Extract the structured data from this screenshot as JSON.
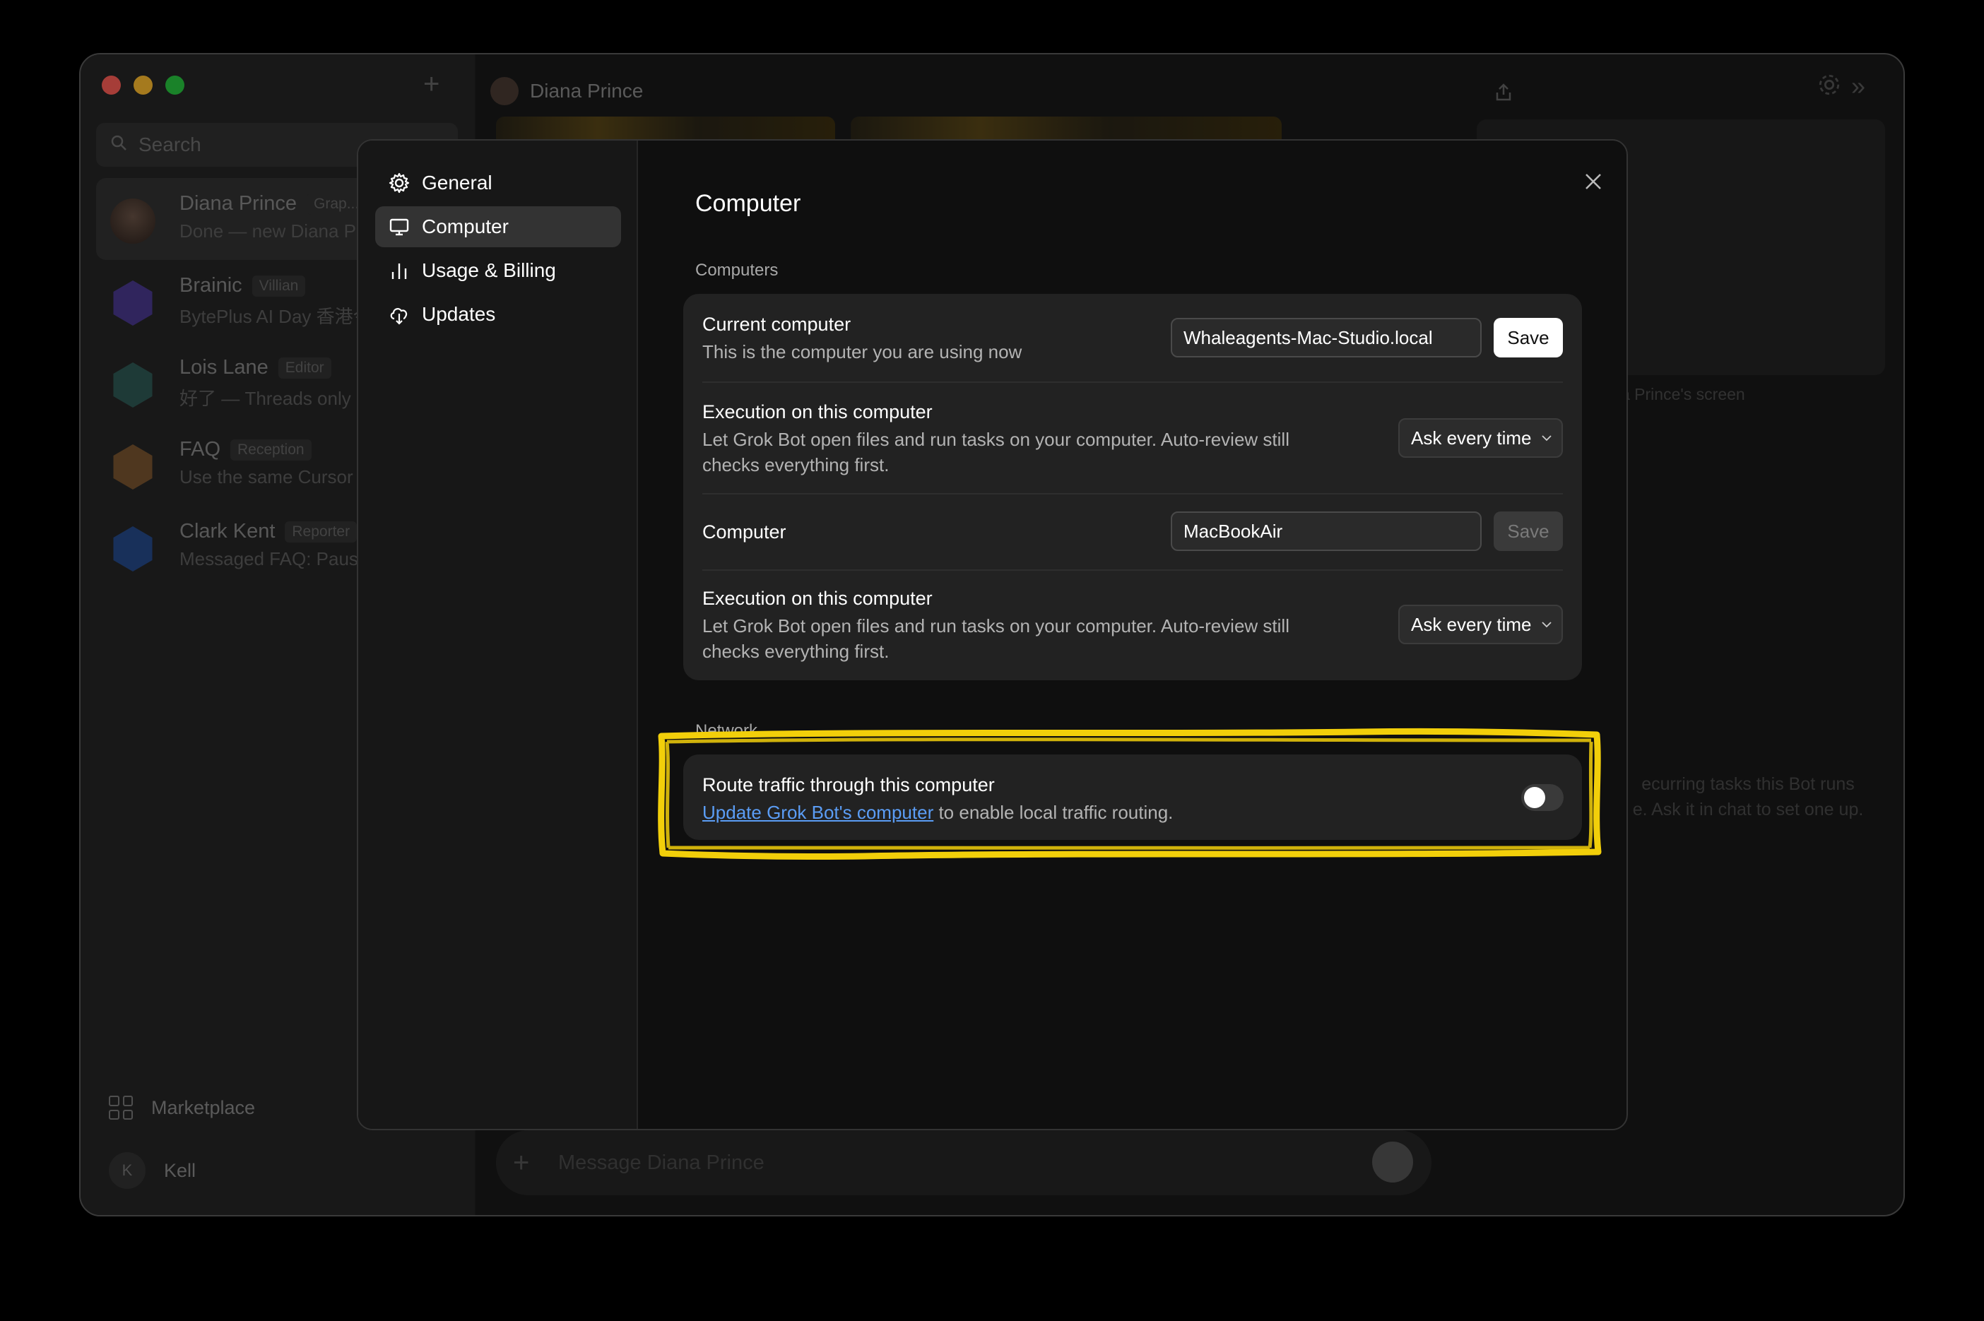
{
  "window": {
    "search_placeholder": "Search",
    "header_title": "Diana Prince",
    "composer_placeholder": "Message Diana Prince",
    "right_panel_caption": "a Prince's screen",
    "right_panel_text": "ecurring tasks this Bot runs\ne. Ask it in chat to set one up."
  },
  "chats": [
    {
      "name": "Diana Prince",
      "tag": "Grap...",
      "preview": "Done — new Diana Pri",
      "color": "#4a3b33"
    },
    {
      "name": "Brainic",
      "tag": "Villian",
      "preview": "BytePlus AI Day 香港今",
      "color": "#4b3a8f"
    },
    {
      "name": "Lois Lane",
      "tag": "Editor",
      "preview": "好了 — Threads only ·",
      "color": "#2f5a55"
    },
    {
      "name": "FAQ",
      "tag": "Reception",
      "preview": "Use the same Cursor",
      "color": "#7a5530"
    },
    {
      "name": "Clark Kent",
      "tag": "Reporter",
      "preview": "Messaged FAQ: Pause",
      "color": "#264a8a"
    }
  ],
  "sidebar_bottom": {
    "marketplace": "Marketplace",
    "user_initial": "K",
    "user_name": "Kell"
  },
  "settings": {
    "nav": [
      {
        "label": "General",
        "icon": "gear-icon"
      },
      {
        "label": "Computer",
        "icon": "monitor-icon",
        "active": true
      },
      {
        "label": "Usage & Billing",
        "icon": "bar-chart-icon"
      },
      {
        "label": "Updates",
        "icon": "cloud-download-icon"
      }
    ],
    "title": "Computer",
    "computers_label": "Computers",
    "current_computer": {
      "title": "Current computer",
      "desc": "This is the computer you are using now",
      "value": "Whaleagents-Mac-Studio.local",
      "save": "Save"
    },
    "execution_1": {
      "title": "Execution on this computer",
      "desc": "Let Grok Bot open files and run tasks on your computer. Auto-review still checks everything first.",
      "select": "Ask every time"
    },
    "computer": {
      "title": "Computer",
      "value": "MacBookAir",
      "save": "Save"
    },
    "execution_2": {
      "title": "Execution on this computer",
      "desc": "Let Grok Bot open files and run tasks on your computer. Auto-review still checks everything first.",
      "select": "Ask every time"
    },
    "network_label": "Network",
    "route": {
      "title": "Route traffic through this computer",
      "link": "Update Grok Bot's computer",
      "desc_rest": " to enable local traffic routing.",
      "enabled": false
    }
  },
  "colors": {
    "highlight": "#f2cf0a",
    "link": "#5b9df5"
  }
}
